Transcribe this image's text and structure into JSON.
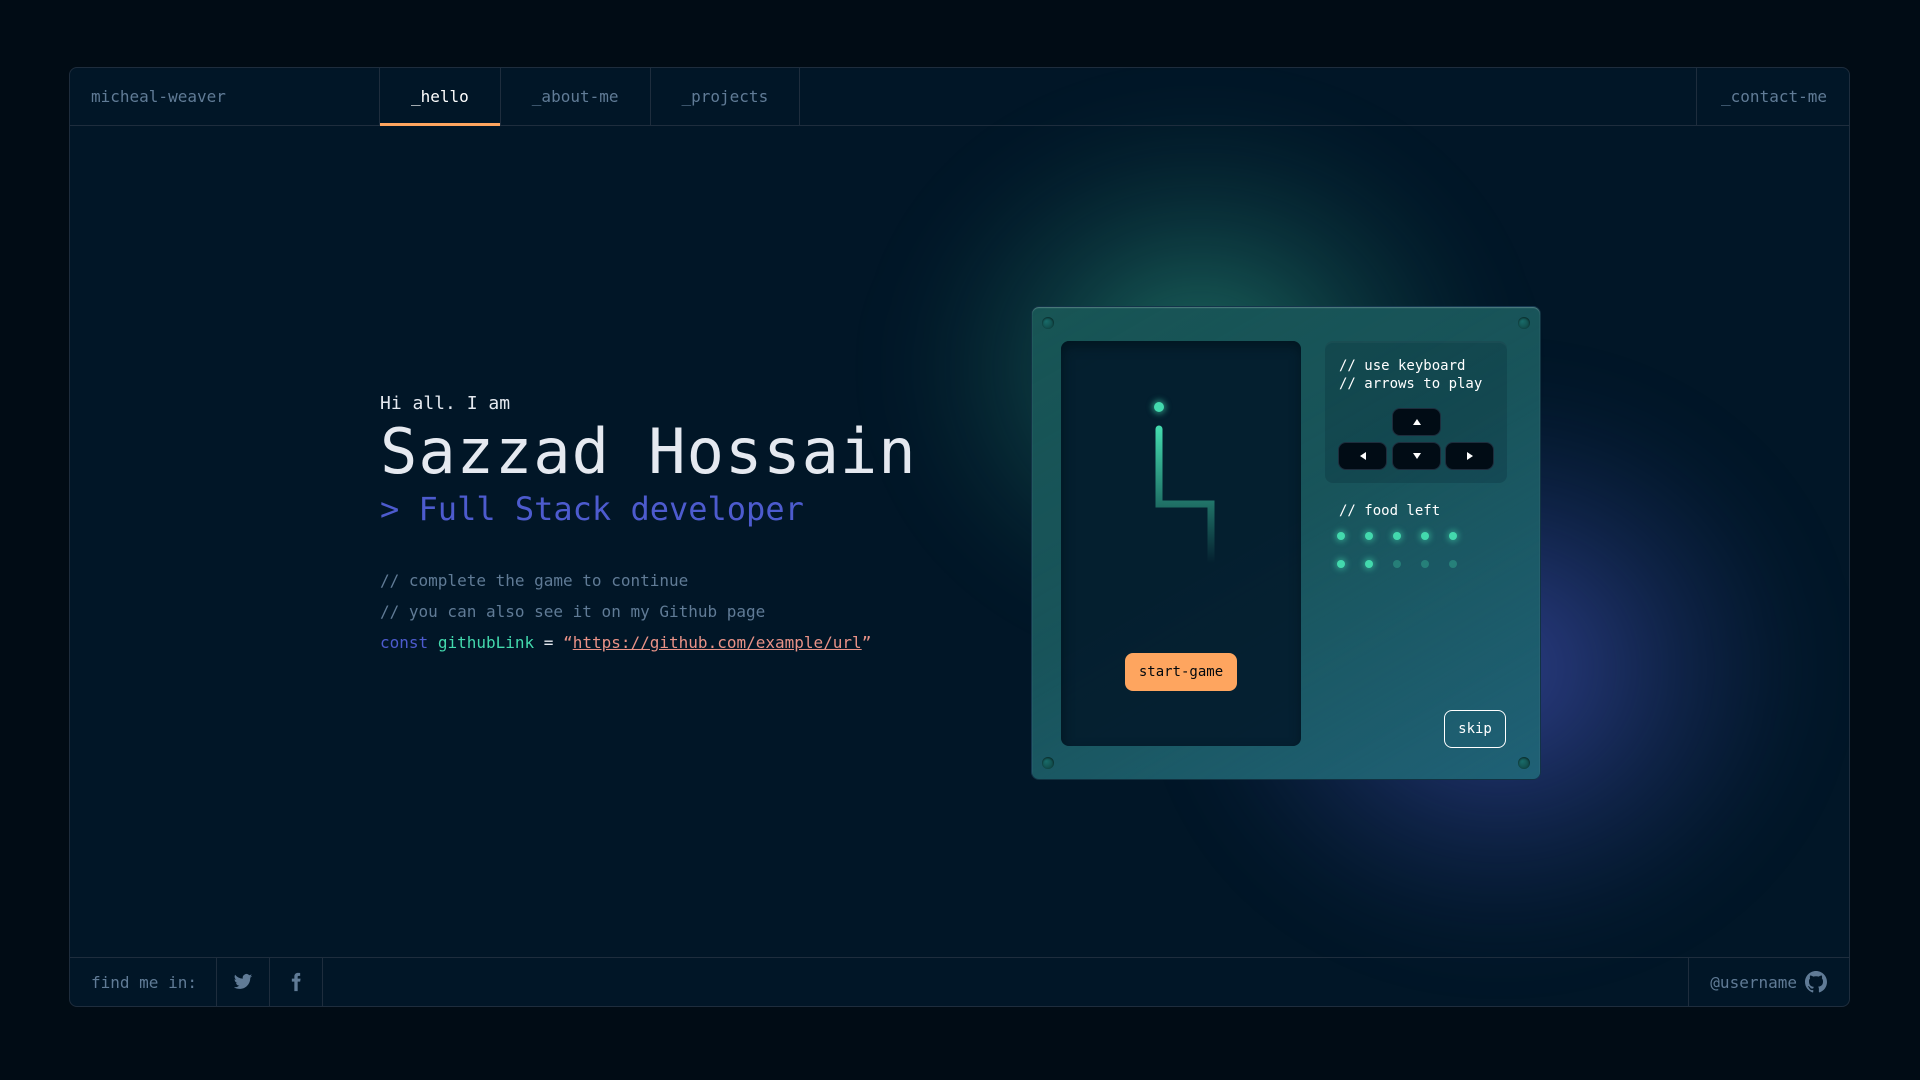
{
  "header": {
    "brand": "micheal-weaver",
    "tabs": [
      {
        "label": "_hello",
        "active": true
      },
      {
        "label": "_about-me",
        "active": false
      },
      {
        "label": "_projects",
        "active": false
      }
    ],
    "contact_label": "_contact-me"
  },
  "hero": {
    "greeting": "Hi all. I am",
    "name": "Sazzad Hossain",
    "role": "> Full Stack developer"
  },
  "code": {
    "comment1": "// complete the game to continue",
    "comment2": "// you can also see it on my Github page",
    "keyword": "const",
    "variable": "githubLink",
    "equals": "=",
    "open_quote": "“",
    "url": "https://github.com/example/url",
    "close_quote": "”"
  },
  "game": {
    "instructions_line1": "// use keyboard",
    "instructions_line2": "// arrows to play",
    "keys": [
      "arrow-up-icon",
      "arrow-left-icon",
      "arrow-down-icon",
      "arrow-right-icon"
    ],
    "food_label": "// food left",
    "food_total": 10,
    "food_remaining": 7,
    "start_label": "start-game",
    "skip_label": "skip"
  },
  "footer": {
    "find_label": "find me in:",
    "socials": [
      "twitter-icon",
      "facebook-icon"
    ],
    "github_user": "@username",
    "github_icon": "github-icon"
  },
  "colors": {
    "background": "#010c15",
    "panel": "#011627",
    "border": "#1e2d3d",
    "text_muted": "#607b96",
    "accent_orange": "#fea55f",
    "accent_green": "#43d9ad",
    "accent_purple": "#4d5bce",
    "string": "#e99287"
  }
}
